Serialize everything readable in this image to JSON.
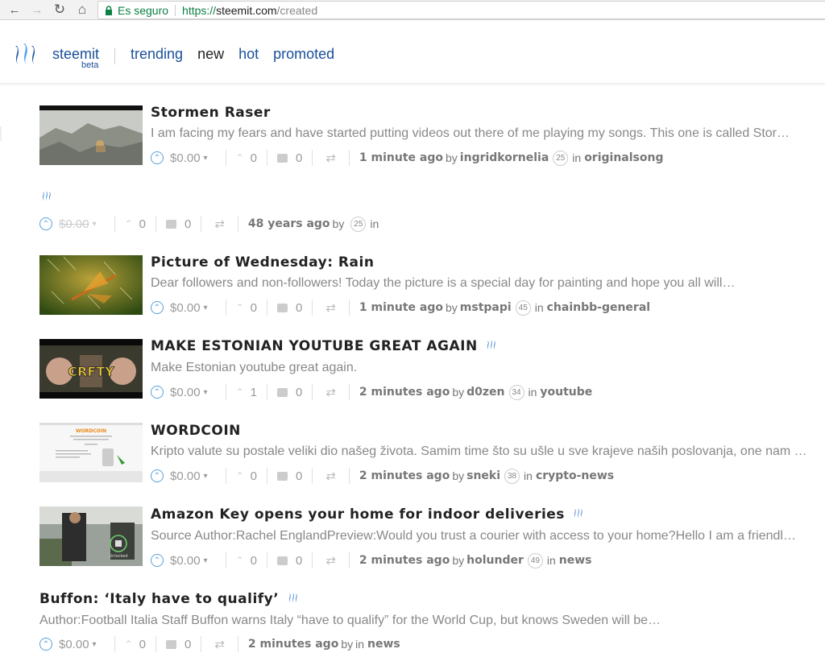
{
  "browser": {
    "back_glyph": "←",
    "forward_glyph": "→",
    "reload_glyph": "↻",
    "home_glyph": "⌂",
    "secure_label": "Es seguro",
    "url_proto": "https://",
    "url_host": "steemit.com",
    "url_path": "/created"
  },
  "header": {
    "brand": "steemit",
    "beta": "beta",
    "nav": [
      {
        "label": "trending",
        "active": false
      },
      {
        "label": "new",
        "active": true
      },
      {
        "label": "hot",
        "active": false
      },
      {
        "label": "promoted",
        "active": false
      }
    ]
  },
  "icons": {
    "upvote": "upvote-icon",
    "caret": "▾",
    "votes_arrow": "⌃",
    "reblog": "⇄"
  },
  "posts": [
    {
      "title": "Stormen Raser",
      "body": "I am facing my fears and have started putting videos out there of me playing my songs. This one is called Stor…",
      "payout": "$0.00",
      "votes": "0",
      "comments": "0",
      "time": "1 minute ago",
      "by": "by",
      "author": "ingridkornelia",
      "rep": "25",
      "in": "in",
      "category": "originalsong"
    },
    {
      "title": "",
      "body": "",
      "payout": "$0.00",
      "votes": "0",
      "comments": "0",
      "time": "48 years ago",
      "by": "by",
      "author": "",
      "rep": "25",
      "in": "in",
      "category": ""
    },
    {
      "title": "Picture of Wednesday: Rain",
      "body": "Dear followers and non-followers! Today the picture is a special day for painting and hope you all will…",
      "payout": "$0.00",
      "votes": "0",
      "comments": "0",
      "time": "1 minute ago",
      "by": "by",
      "author": "mstpapi",
      "rep": "45",
      "in": "in",
      "category": "chainbb-general"
    },
    {
      "title": "MAKE ESTONIAN YOUTUBE GREAT AGAIN",
      "body": "Make Estonian youtube great again.",
      "payout": "$0.00",
      "votes": "1",
      "comments": "0",
      "time": "2 minutes ago",
      "by": "by",
      "author": "d0zen",
      "rep": "34",
      "in": "in",
      "category": "youtube",
      "thumb_text": "CRFTY"
    },
    {
      "title": "WORDCOIN",
      "body": "Kripto valute su postale veliki dio našeg života. Samim time što su ušle u sve krajeve naših poslovanja, one nam …",
      "payout": "$0.00",
      "votes": "0",
      "comments": "0",
      "time": "2 minutes ago",
      "by": "by",
      "author": "sneki",
      "rep": "38",
      "in": "in",
      "category": "crypto-news",
      "thumb_text": "WORDCOIN"
    },
    {
      "title": "Amazon Key opens your home for indoor deliveries",
      "body": "Source Author:Rachel EnglandPreview:Would you trust a courier with access to your home?Hello I am a friendl…",
      "payout": "$0.00",
      "votes": "0",
      "comments": "0",
      "time": "2 minutes ago",
      "by": "by",
      "author": "holunder",
      "rep": "49",
      "in": "in",
      "category": "news",
      "thumb_text": "Unlocked"
    },
    {
      "title": "Buffon: ‘Italy have to qualify’",
      "body": "Author:Football Italia Staff Buffon warns Italy “have to qualify” for the World Cup, but knows Sweden will be…",
      "payout": "$0.00",
      "votes": "0",
      "comments": "0",
      "time": "2 minutes ago",
      "by": "by",
      "author": "",
      "rep": "",
      "in": "in",
      "category": "news"
    }
  ]
}
